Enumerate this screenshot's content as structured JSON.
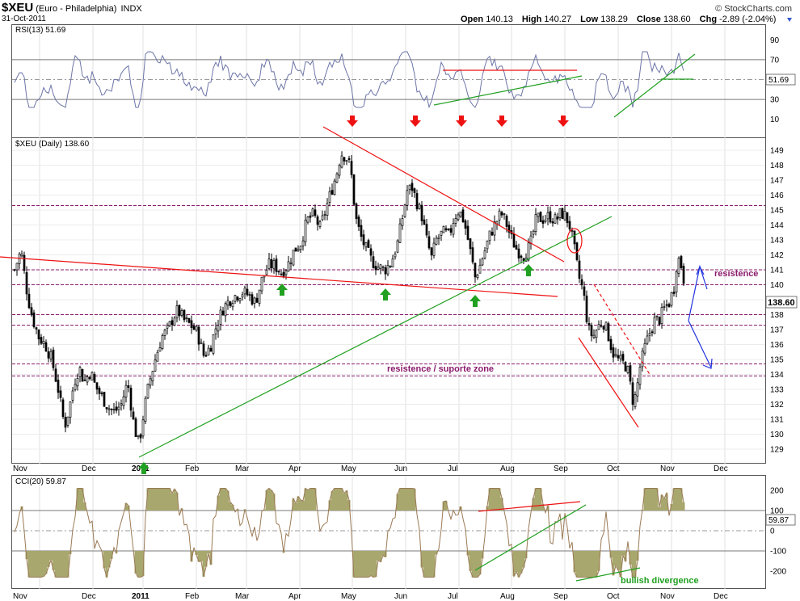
{
  "header": {
    "symbol": "$XEU",
    "name": "(Euro - Philadelphia)",
    "exchange": "INDX",
    "date": "31-Oct-2011",
    "brand": "© StockCharts.com",
    "open_label": "Open",
    "open": "140.13",
    "high_label": "High",
    "high": "140.27",
    "low_label": "Low",
    "low": "138.29",
    "close_label": "Close",
    "close": "138.60",
    "chg_label": "Chg",
    "chg": "-2.89 (-2.04%)"
  },
  "colors": {
    "candle": "#000000",
    "resist_dash": "#8b1a6b",
    "red": "#ee1111",
    "green": "#21a021",
    "blue": "#2233dd",
    "rsi_line": "#6d75a8",
    "cci_line": "#9b7a55",
    "cci_fill": "#a7a76e"
  },
  "chart_data": [
    {
      "type": "line",
      "title": "RSI(13) 51.69",
      "series": [
        {
          "name": "RSI(13)",
          "last": "51.69"
        }
      ],
      "ylim": [
        0,
        100
      ],
      "yticks": [
        "90",
        "70",
        "50",
        "30",
        "10"
      ],
      "ref_lines": [
        70,
        30
      ]
    },
    {
      "type": "candlestick",
      "title": "$XEU (Daily) 138.60",
      "ylim": [
        128.5,
        150
      ],
      "yticks": [
        "149",
        "148",
        "147",
        "146",
        "145",
        "144",
        "143",
        "142",
        "141",
        "140",
        "139",
        "138",
        "137",
        "136",
        "135",
        "134",
        "133",
        "132",
        "131",
        "130",
        "129"
      ],
      "xticks": [
        "Nov",
        "Dec",
        "2011",
        "Feb",
        "Mar",
        "Apr",
        "May",
        "Jun",
        "Jul",
        "Aug",
        "Sep",
        "Oct",
        "Nov",
        "Dec"
      ],
      "last_price": "138.60",
      "horizontal_levels": [
        145.3,
        141.0,
        140.0,
        138.0,
        137.3,
        134.7,
        133.9
      ],
      "annotations": [
        {
          "text": "resistence",
          "color": "#8b1a6b"
        },
        {
          "text": "resistence / suporte zone",
          "color": "#8b1a6b"
        }
      ]
    },
    {
      "type": "line",
      "title": "CCI(20) 59.87",
      "series": [
        {
          "name": "CCI(20)",
          "last": "59.87"
        }
      ],
      "ylim": [
        -260,
        260
      ],
      "yticks": [
        "200",
        "100",
        "0",
        "-100",
        "-200"
      ],
      "ref_lines": [
        100,
        -100
      ],
      "annotations": [
        {
          "text": "bullish divergence",
          "color": "#21a021"
        }
      ]
    }
  ]
}
